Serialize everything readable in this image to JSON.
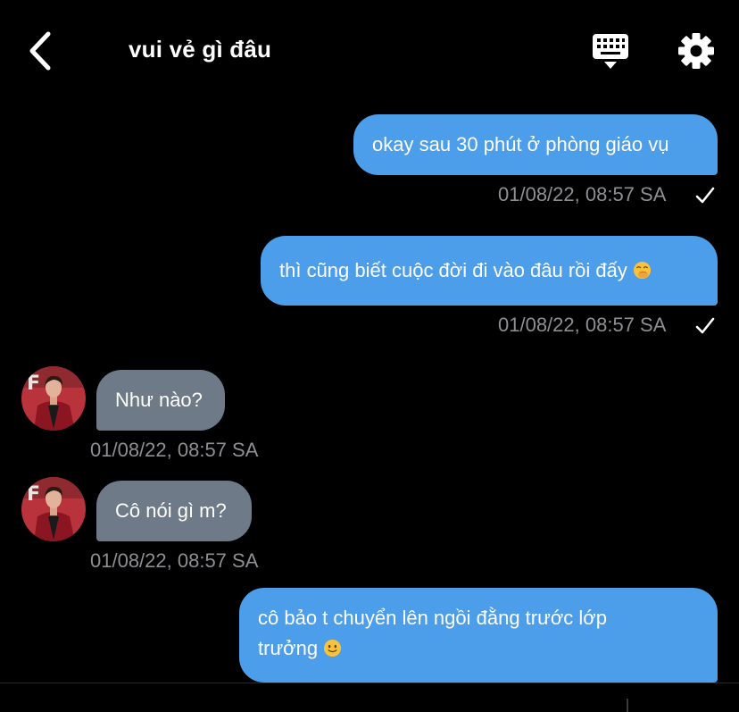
{
  "header": {
    "title": "vui vẻ gì đâu"
  },
  "icons": {
    "back": "chevron-left-icon",
    "keyboard": "keyboard-icon",
    "settings": "gear-icon",
    "read": "checkmark-icon"
  },
  "colors": {
    "background": "#000000",
    "outgoing_bubble": "#4c9eea",
    "incoming_bubble": "#6e7a87",
    "timestamp": "#8e8e93"
  },
  "messages": [
    {
      "direction": "outgoing",
      "text": "okay sau 30 phút ở phòng giáo vụ",
      "timestamp": "01/08/22, 08:57 SA",
      "read": true
    },
    {
      "direction": "outgoing",
      "text": "thì cũng biết cuộc đời đi vào đâu rồi đấy",
      "emoji": "hand-over-mouth-emoji",
      "timestamp": "01/08/22, 08:57 SA",
      "read": true
    },
    {
      "direction": "incoming",
      "text": "Như nào?",
      "timestamp": "01/08/22, 08:57 SA"
    },
    {
      "direction": "incoming",
      "text": "Cô nói gì m?",
      "timestamp": "01/08/22, 08:57 SA"
    },
    {
      "direction": "outgoing",
      "text_line1": "cô bảo t chuyển lên ngồi đằng trước lớp",
      "text_line2": "trưởng",
      "emoji": "slight-smile-emoji"
    }
  ]
}
